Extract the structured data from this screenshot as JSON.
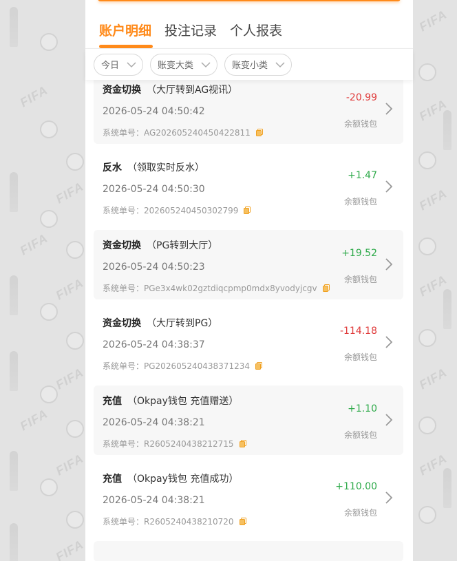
{
  "background": {
    "watermark_text": "FIFA"
  },
  "tabs": [
    {
      "label": "账户明细",
      "active": true
    },
    {
      "label": "投注记录",
      "active": false
    },
    {
      "label": "个人报表",
      "active": false
    }
  ],
  "filters": [
    {
      "label": "今日"
    },
    {
      "label": "账变大类"
    },
    {
      "label": "账变小类"
    }
  ],
  "records": [
    {
      "type": "资金切换",
      "detail": "（大厅转到AG视讯）",
      "time": "2026-05-24 04:50:42",
      "order_label": "系统单号：",
      "order_no": "AG202605240450422811",
      "amount": "-20.99",
      "sign": "neg",
      "wallet": "余额钱包"
    },
    {
      "type": "反水",
      "detail": "（领取实时反水）",
      "time": "2026-05-24 04:50:30",
      "order_label": "系统单号：",
      "order_no": "202605240450302799",
      "amount": "+1.47",
      "sign": "pos",
      "wallet": "余额钱包"
    },
    {
      "type": "资金切换",
      "detail": "（PG转到大厅）",
      "time": "2026-05-24 04:50:23",
      "order_label": "系统单号：",
      "order_no": "PGe3x4wk02gztdiqcpmp0mdx8yvodyjcgv",
      "amount": "+19.52",
      "sign": "pos",
      "wallet": "余额钱包"
    },
    {
      "type": "资金切换",
      "detail": "（大厅转到PG）",
      "time": "2026-05-24 04:38:37",
      "order_label": "系统单号：",
      "order_no": "PG202605240438371234",
      "amount": "-114.18",
      "sign": "neg",
      "wallet": "余额钱包"
    },
    {
      "type": "充值",
      "detail": "（Okpay钱包 充值赠送）",
      "time": "2026-05-24 04:38:21",
      "order_label": "系统单号：",
      "order_no": "R2605240438212715",
      "amount": "+1.10",
      "sign": "pos",
      "wallet": "余额钱包"
    },
    {
      "type": "充值",
      "detail": "（Okpay钱包 充值成功）",
      "time": "2026-05-24 04:38:21",
      "order_label": "系统单号：",
      "order_no": "R2605240438210720",
      "amount": "+110.00",
      "sign": "pos",
      "wallet": "余额钱包"
    }
  ],
  "colors": {
    "accent": "#ff8a1a",
    "negative": "#e03c3c",
    "positive": "#2eaa4a"
  }
}
